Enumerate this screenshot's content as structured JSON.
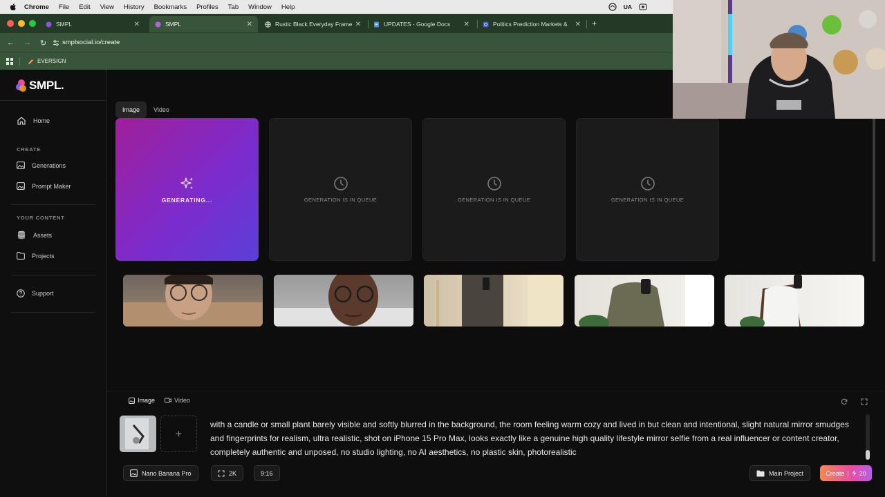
{
  "menubar": {
    "app_name": "Chrome",
    "items": [
      "File",
      "Edit",
      "View",
      "History",
      "Bookmarks",
      "Profiles",
      "Tab",
      "Window",
      "Help"
    ],
    "input_source": "UA"
  },
  "browser": {
    "tabs": [
      {
        "title": "SMPL",
        "active": false
      },
      {
        "title": "SMPL",
        "active": true
      },
      {
        "title": "Rustic Black Everyday Frame",
        "active": false
      },
      {
        "title": "UPDATES - Google Docs",
        "active": false
      },
      {
        "title": "Politics Prediction Markets &",
        "active": false
      }
    ],
    "new_tab": "+",
    "url": "smplsocial.io/create",
    "bookmark": "EVERSIGN"
  },
  "sidebar": {
    "logo": "SMPL.",
    "home": "Home",
    "create_heading": "CREATE",
    "create_items": [
      "Generations",
      "Prompt Maker"
    ],
    "content_heading": "YOUR CONTENT",
    "content_items": [
      "Assets",
      "Projects"
    ],
    "support": "Support"
  },
  "main": {
    "tabs": [
      "Image",
      "Video"
    ],
    "active_tab": "Image",
    "cards": [
      {
        "status": "GENERATING..."
      },
      {
        "status": "GENERATION IS IN QUEUE"
      },
      {
        "status": "GENERATION IS IN QUEUE"
      },
      {
        "status": "GENERATION IS IN QUEUE"
      }
    ]
  },
  "composer": {
    "tabs": [
      "Image",
      "Video"
    ],
    "prompt": "with a candle or small plant barely visible and softly blurred in the background, the room feeling warm cozy and lived in but clean and intentional, slight natural mirror smudges and fingerprints for realism, ultra realistic, shot on iPhone 15 Pro Max, looks exactly like a genuine high quality lifestyle mirror selfie from a real influencer or content creator, completely authentic and unposed, no studio lighting, no AI aesthetics, no plastic skin, photorealistic",
    "add_slot": "+",
    "model": "Nano Banana Pro",
    "resolution": "2K",
    "aspect": "9:16",
    "project": "Main Project",
    "create_label": "Create",
    "create_sep": "|",
    "create_cost": "20"
  },
  "colors": {
    "accent_gradient": [
      "#a01f9a",
      "#5a3fd9"
    ],
    "browser_green": "#38553b"
  }
}
